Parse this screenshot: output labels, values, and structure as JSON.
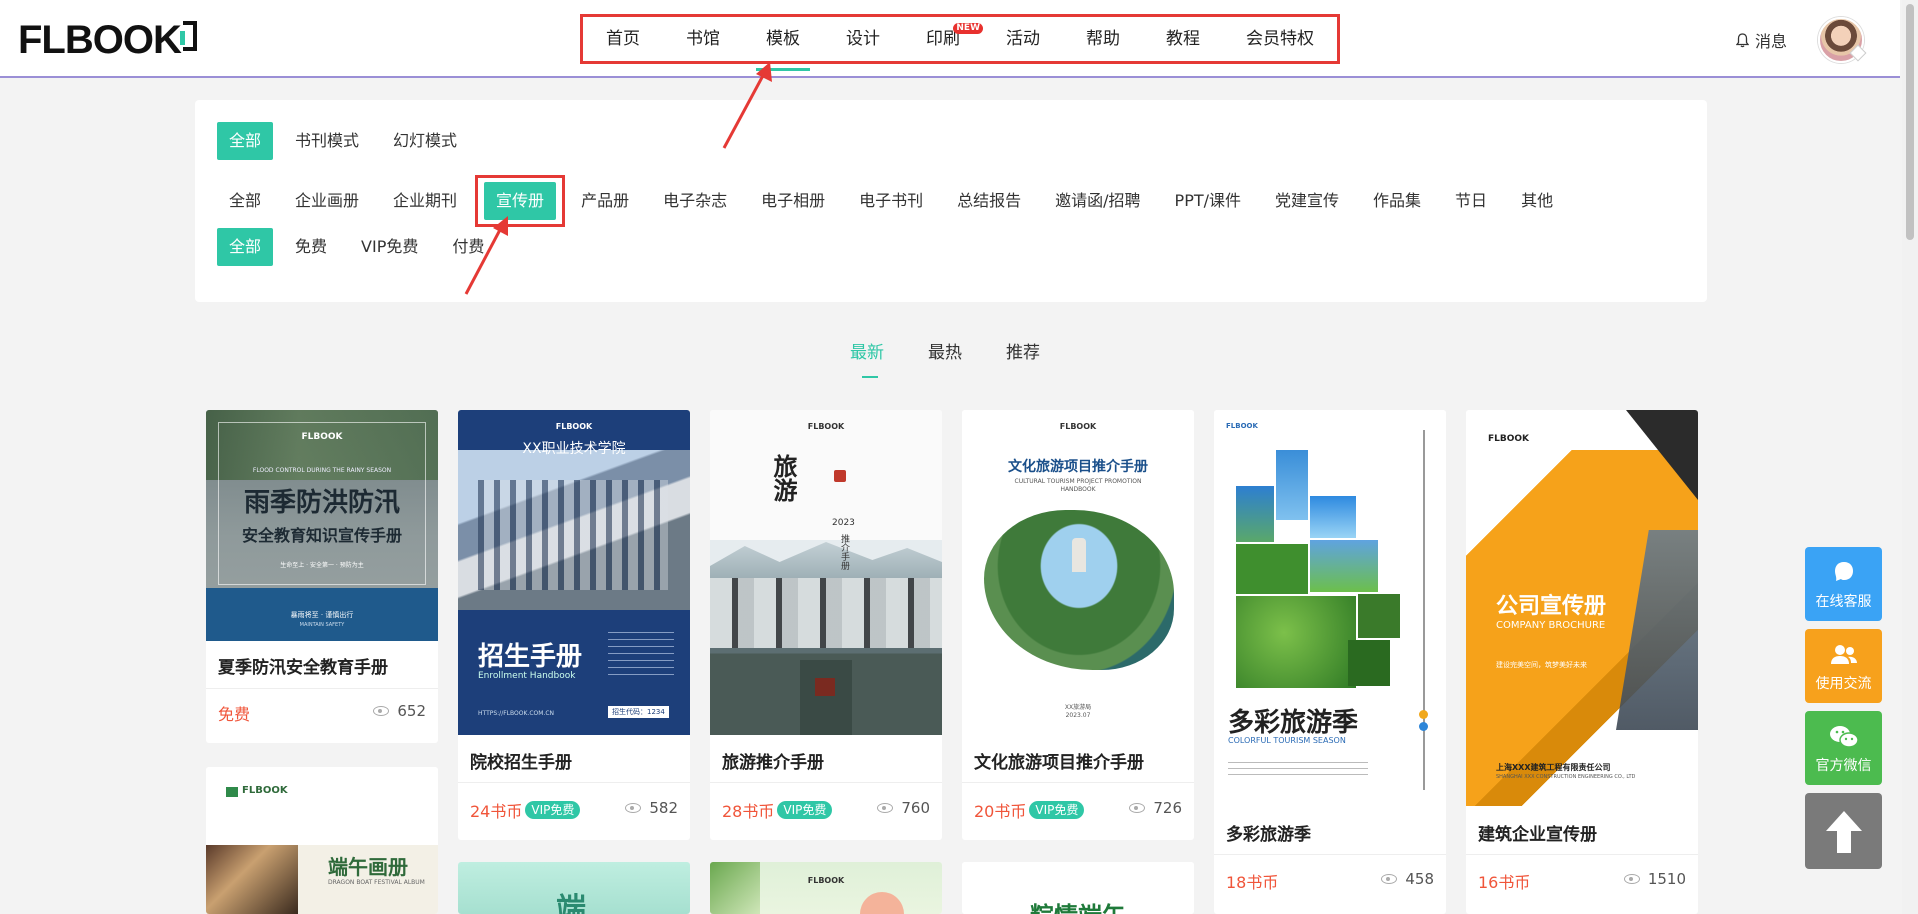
{
  "header": {
    "logo": "FLBOOK",
    "nav": [
      {
        "label": "首页"
      },
      {
        "label": "书馆"
      },
      {
        "label": "模板"
      },
      {
        "label": "设计"
      },
      {
        "label": "印刷",
        "badge": "NEW"
      },
      {
        "label": "活动"
      },
      {
        "label": "帮助"
      },
      {
        "label": "教程"
      },
      {
        "label": "会员特权"
      }
    ],
    "active_nav": "模板",
    "message_label": "消息"
  },
  "filters": {
    "mode": [
      "全部",
      "书刊模式",
      "幻灯模式"
    ],
    "category": [
      "全部",
      "企业画册",
      "企业期刊",
      "宣传册",
      "产品册",
      "电子杂志",
      "电子相册",
      "电子书刊",
      "总结报告",
      "邀请函/招聘",
      "PPT/课件",
      "党建宣传",
      "作品集",
      "节日",
      "其他"
    ],
    "price": [
      "全部",
      "免费",
      "VIP免费",
      "付费"
    ],
    "selected": {
      "mode": "全部",
      "category": "宣传册",
      "price": "全部"
    }
  },
  "sort_tabs": [
    "最新",
    "最热",
    "推荐"
  ],
  "active_sort": "最新",
  "cards": [
    {
      "title": "夏季防汛安全教育手册",
      "price": "免费",
      "vip": "",
      "views": "652",
      "cover": {
        "brand": "FLBOOK",
        "en": "FLOOD CONTROL DURING THE RAINY SEASON",
        "headline": "雨季防洪防汛",
        "sub": "安全教育知识宣传手册",
        "small": "生命至上 · 安全第一 · 预防为主",
        "footer": "暴雨将至 · 谨慎出行",
        "footer_en": "MAINTAIN SAFETY"
      }
    },
    {
      "title": "院校招生手册",
      "price": "24书币",
      "vip": "VIP免费",
      "views": "582",
      "cover": {
        "brand": "FLBOOK",
        "school": "XX职业技术学院",
        "headline": "招生手册",
        "en": "Enrollment Handbook",
        "url": "HTTPS://FLBOOK.COM.CN",
        "code": "招生代码：1234"
      }
    },
    {
      "title": "旅游推介手册",
      "price": "28书币",
      "vip": "VIP免费",
      "views": "760",
      "cover": {
        "brand": "FLBOOK",
        "headline": "旅游",
        "year": "2023",
        "sub": "推介手册"
      }
    },
    {
      "title": "文化旅游项目推介手册",
      "price": "20书币",
      "vip": "VIP免费",
      "views": "726",
      "cover": {
        "brand": "FLBOOK",
        "headline": "文化旅游项目推介手册",
        "en": "CULTURAL TOURISM PROJECT PROMOTION HANDBOOK",
        "footer": "XX旅游局",
        "date": "2023.07"
      }
    },
    {
      "title": "多彩旅游季",
      "price": "18书币",
      "vip": "",
      "views": "458",
      "cover": {
        "brand": "FLBOOK",
        "headline": "多彩旅游季",
        "en": "COLORFUL TOURISM SEASON"
      }
    },
    {
      "title": "建筑企业宣传册",
      "price": "16书币",
      "vip": "",
      "views": "1510",
      "cover": {
        "brand": "FLBOOK",
        "headline": "公司宣传册",
        "en": "COMPANY BROCHURE",
        "slogan": "建设完美空间，筑梦美好未来",
        "company": "上海XXX建筑工程有限责任公司",
        "company_en": "SHANGHAI XXX CONSTRUCTION ENGINEERING CO., LTD"
      }
    }
  ],
  "partial_covers": [
    {
      "brand": "FLBOOK",
      "headline": "端午画册",
      "en": "DRAGON BOAT FESTIVAL ALBUM"
    },
    {
      "headline": "端"
    },
    {
      "brand": "FLBOOK"
    },
    {
      "headline": "粽情端午"
    }
  ],
  "side_buttons": [
    {
      "label": "在线客服",
      "color": "#3aa3f5",
      "icon": "chat-bubble-icon"
    },
    {
      "label": "使用交流",
      "color": "#f7a11c",
      "icon": "users-icon"
    },
    {
      "label": "官方微信",
      "color": "#4cbb4f",
      "icon": "wechat-icon"
    },
    {
      "label": "",
      "color": "#7a7a7a",
      "icon": "back-to-top-icon"
    }
  ],
  "colors": {
    "accent": "#2fc7a6",
    "price": "#f0553a",
    "annotation": "#e53935"
  }
}
